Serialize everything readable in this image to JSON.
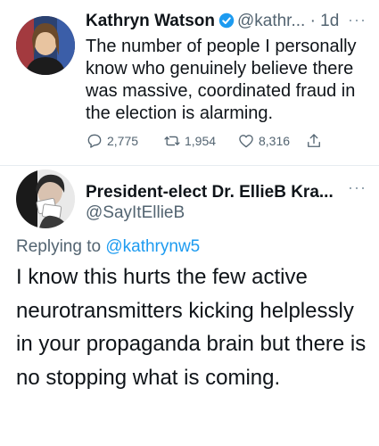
{
  "tweet1": {
    "display_name": "Kathryn Watson",
    "handle_time": "@kathr... · 1d",
    "text": "The number of people I personally know who genuinely believe there was massive, coordinated fraud in the election is alarming.",
    "replies": "2,775",
    "retweets": "1,954",
    "likes": "8,316",
    "more": "···"
  },
  "tweet2": {
    "display_name": "President-elect Dr. EllieB Kra...",
    "handle": "@SayItEllieB",
    "replying_prefix": "Replying to ",
    "replying_mention": "@kathrynw5",
    "text": "I know this hurts the few active neurotransmitters kicking helplessly in your propaganda brain but there is no stopping what is coming.",
    "more": "···"
  },
  "colors": {
    "accent": "#1d9bf0",
    "muted": "#536471",
    "text": "#0f1419"
  }
}
